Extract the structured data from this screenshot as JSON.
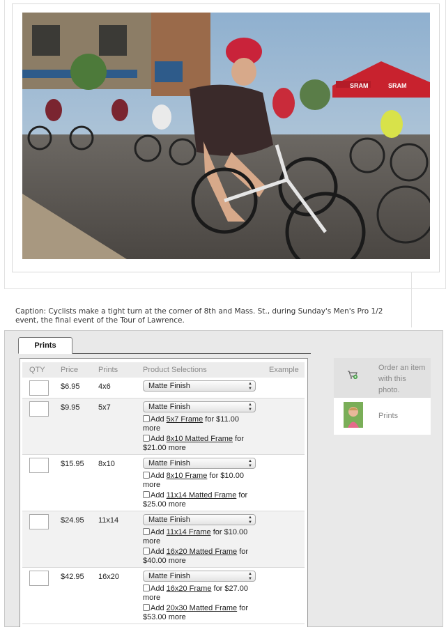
{
  "photo": {
    "banner_text_1": "SRAM",
    "banner_text_2": "SRAM"
  },
  "caption": "Caption: Cyclists make a tight turn at the corner of 8th and Mass. St., during Sunday's Men's Pro 1/2 event, the final event of the Tour of Lawrence.",
  "tabs": [
    {
      "label": "Prints"
    }
  ],
  "table": {
    "headers": {
      "qty": "QTY",
      "price": "Price",
      "prints": "Prints",
      "product": "Product Selections",
      "example": "Example"
    },
    "rows": [
      {
        "price": "$6.95",
        "size": "4x6",
        "finish": "Matte Finish",
        "options": []
      },
      {
        "price": "$9.95",
        "size": "5x7",
        "finish": "Matte Finish",
        "options": [
          {
            "pre": "Add ",
            "link": "5x7 Frame",
            "post": " for $11.00 more"
          },
          {
            "pre": "Add ",
            "link": "8x10 Matted Frame",
            "post": " for $21.00 more"
          }
        ]
      },
      {
        "price": "$15.95",
        "size": "8x10",
        "finish": "Matte Finish",
        "options": [
          {
            "pre": "Add ",
            "link": "8x10 Frame",
            "post": " for $10.00 more"
          },
          {
            "pre": "Add ",
            "link": "11x14 Matted Frame",
            "post": " for $25.00 more"
          }
        ]
      },
      {
        "price": "$24.95",
        "size": "11x14",
        "finish": "Matte Finish",
        "options": [
          {
            "pre": "Add ",
            "link": "11x14 Frame",
            "post": " for $10.00 more"
          },
          {
            "pre": "Add ",
            "link": "16x20 Matted Frame",
            "post": " for $40.00 more"
          }
        ]
      },
      {
        "price": "$42.95",
        "size": "16x20",
        "finish": "Matte Finish",
        "options": [
          {
            "pre": "Add ",
            "link": "16x20 Frame",
            "post": " for $27.00 more"
          },
          {
            "pre": "Add ",
            "link": "20x30 Matted Frame",
            "post": " for $53.00 more"
          }
        ]
      }
    ]
  },
  "sidebar": {
    "order_text": "Order an item with this photo.",
    "prints_label": "Prints"
  }
}
